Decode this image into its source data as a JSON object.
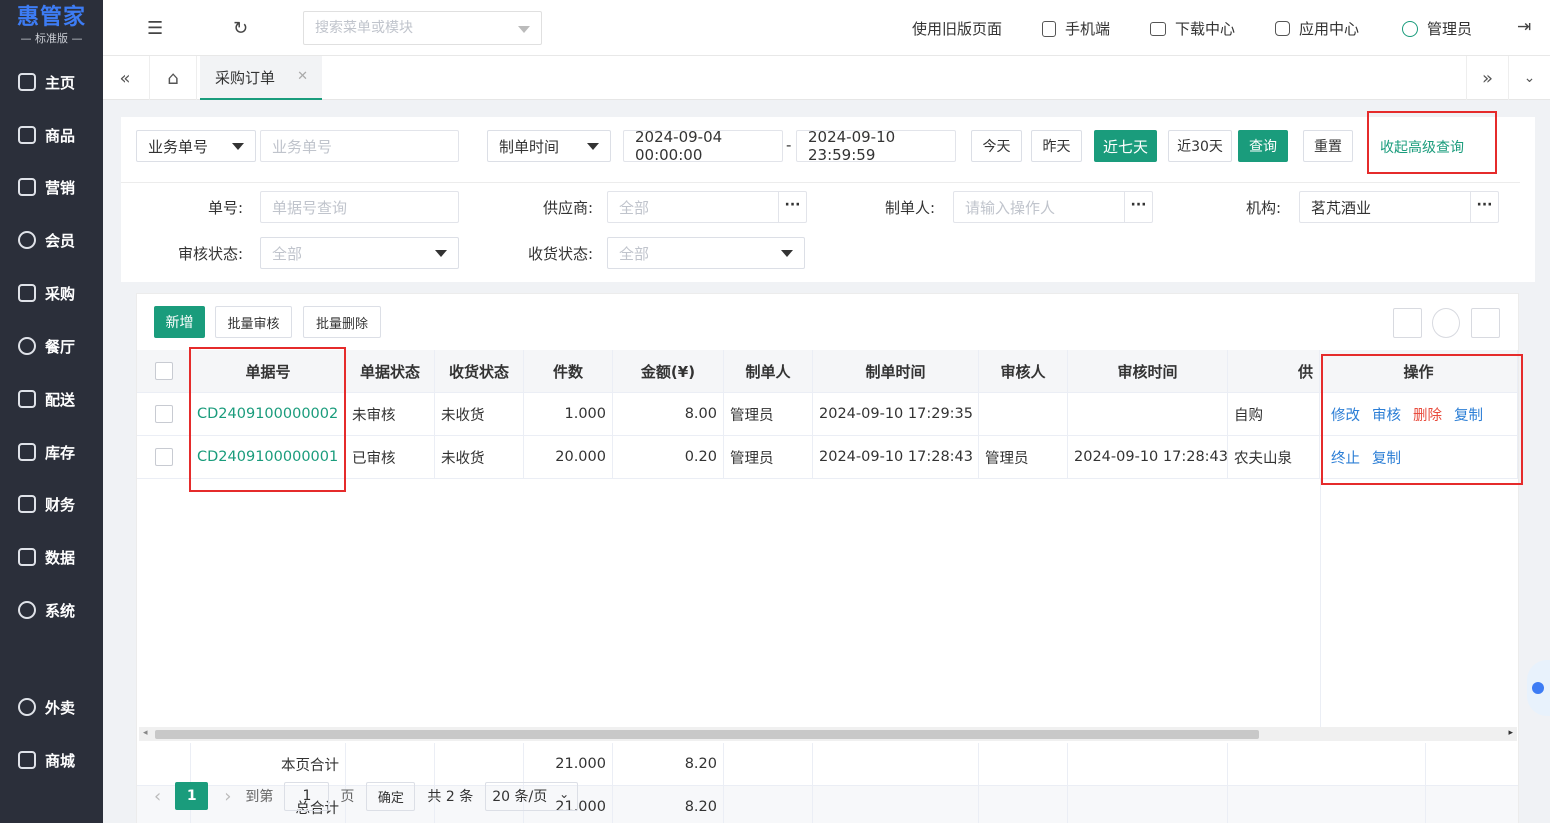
{
  "app": {
    "brand": "惠管家",
    "edition": "— 标准版 —"
  },
  "sidebar": {
    "items": [
      {
        "label": "主页",
        "icon": "home-icon"
      },
      {
        "label": "商品",
        "icon": "box-icon"
      },
      {
        "label": "营销",
        "icon": "chart-icon"
      },
      {
        "label": "会员",
        "icon": "diamond-icon"
      },
      {
        "label": "采购",
        "icon": "cart-icon"
      },
      {
        "label": "餐厅",
        "icon": "cloche-icon"
      },
      {
        "label": "配送",
        "icon": "delivery-icon"
      },
      {
        "label": "库存",
        "icon": "inventory-icon"
      },
      {
        "label": "财务",
        "icon": "finance-icon"
      },
      {
        "label": "数据",
        "icon": "data-icon"
      },
      {
        "label": "系统",
        "icon": "gear-icon"
      },
      {
        "label": "外卖",
        "icon": "bike-icon"
      },
      {
        "label": "商城",
        "icon": "shop-icon"
      }
    ]
  },
  "topbar": {
    "search_placeholder": "搜索菜单或模块",
    "old_page": "使用旧版页面",
    "mobile": "手机端",
    "download": "下载中心",
    "apps": "应用中心",
    "user": "管理员"
  },
  "tabs": {
    "active": "采购订单"
  },
  "filters": {
    "field_select": "业务单号",
    "field_placeholder": "业务单号",
    "time_select": "制单时间",
    "date_start": "2024-09-04 00:00:00",
    "date_sep": "-",
    "date_end": "2024-09-10 23:59:59",
    "today": "今天",
    "yesterday": "昨天",
    "last7": "近七天",
    "last30": "近30天",
    "query": "查询",
    "reset": "重置",
    "collapse": "收起高级查询",
    "order_no_label": "单号:",
    "order_no_placeholder": "单据号查询",
    "supplier_label": "供应商:",
    "supplier_value": "全部",
    "creator_label": "制单人:",
    "creator_placeholder": "请输入操作人",
    "org_label": "机构:",
    "org_value": "茗芃酒业",
    "audit_label": "审核状态:",
    "audit_value": "全部",
    "receive_label": "收货状态:",
    "receive_value": "全部"
  },
  "toolbar": {
    "add": "新增",
    "batch_audit": "批量审核",
    "batch_delete": "批量删除"
  },
  "table": {
    "headers": [
      "单据号",
      "单据状态",
      "收货状态",
      "件数",
      "金额(¥)",
      "制单人",
      "制单时间",
      "审核人",
      "审核时间",
      "供",
      "操作"
    ],
    "rows": [
      {
        "no": "CD2409100000002",
        "status": "未审核",
        "receive": "未收货",
        "qty": "1.000",
        "amount": "8.00",
        "creator": "管理员",
        "created": "2024-09-10 17:29:35",
        "auditor": "",
        "audited": "",
        "supplier": "自购",
        "actions": [
          "修改",
          "审核",
          "删除",
          "复制"
        ]
      },
      {
        "no": "CD2409100000001",
        "status": "已审核",
        "receive": "未收货",
        "qty": "20.000",
        "amount": "0.20",
        "creator": "管理员",
        "created": "2024-09-10 17:28:43",
        "auditor": "管理员",
        "audited": "2024-09-10 17:28:43",
        "supplier": "农夫山泉",
        "actions": [
          "终止",
          "复制"
        ]
      }
    ],
    "page_total_label": "本页合计",
    "page_total_qty": "21.000",
    "page_total_amount": "8.20",
    "grand_total_label": "总合计",
    "grand_total_qty": "21.000",
    "grand_total_amount": "8.20"
  },
  "pager": {
    "current": "1",
    "goto": "到第",
    "page_input": "1",
    "page_unit": "页",
    "confirm": "确定",
    "total": "共 2 条",
    "page_size": "20 条/页"
  },
  "colors": {
    "accent": "#1a9c7c",
    "sidebar": "#2b2f3a",
    "danger": "#e84b3d",
    "link": "#2d7fd6",
    "highlight": "#e52b2b"
  }
}
